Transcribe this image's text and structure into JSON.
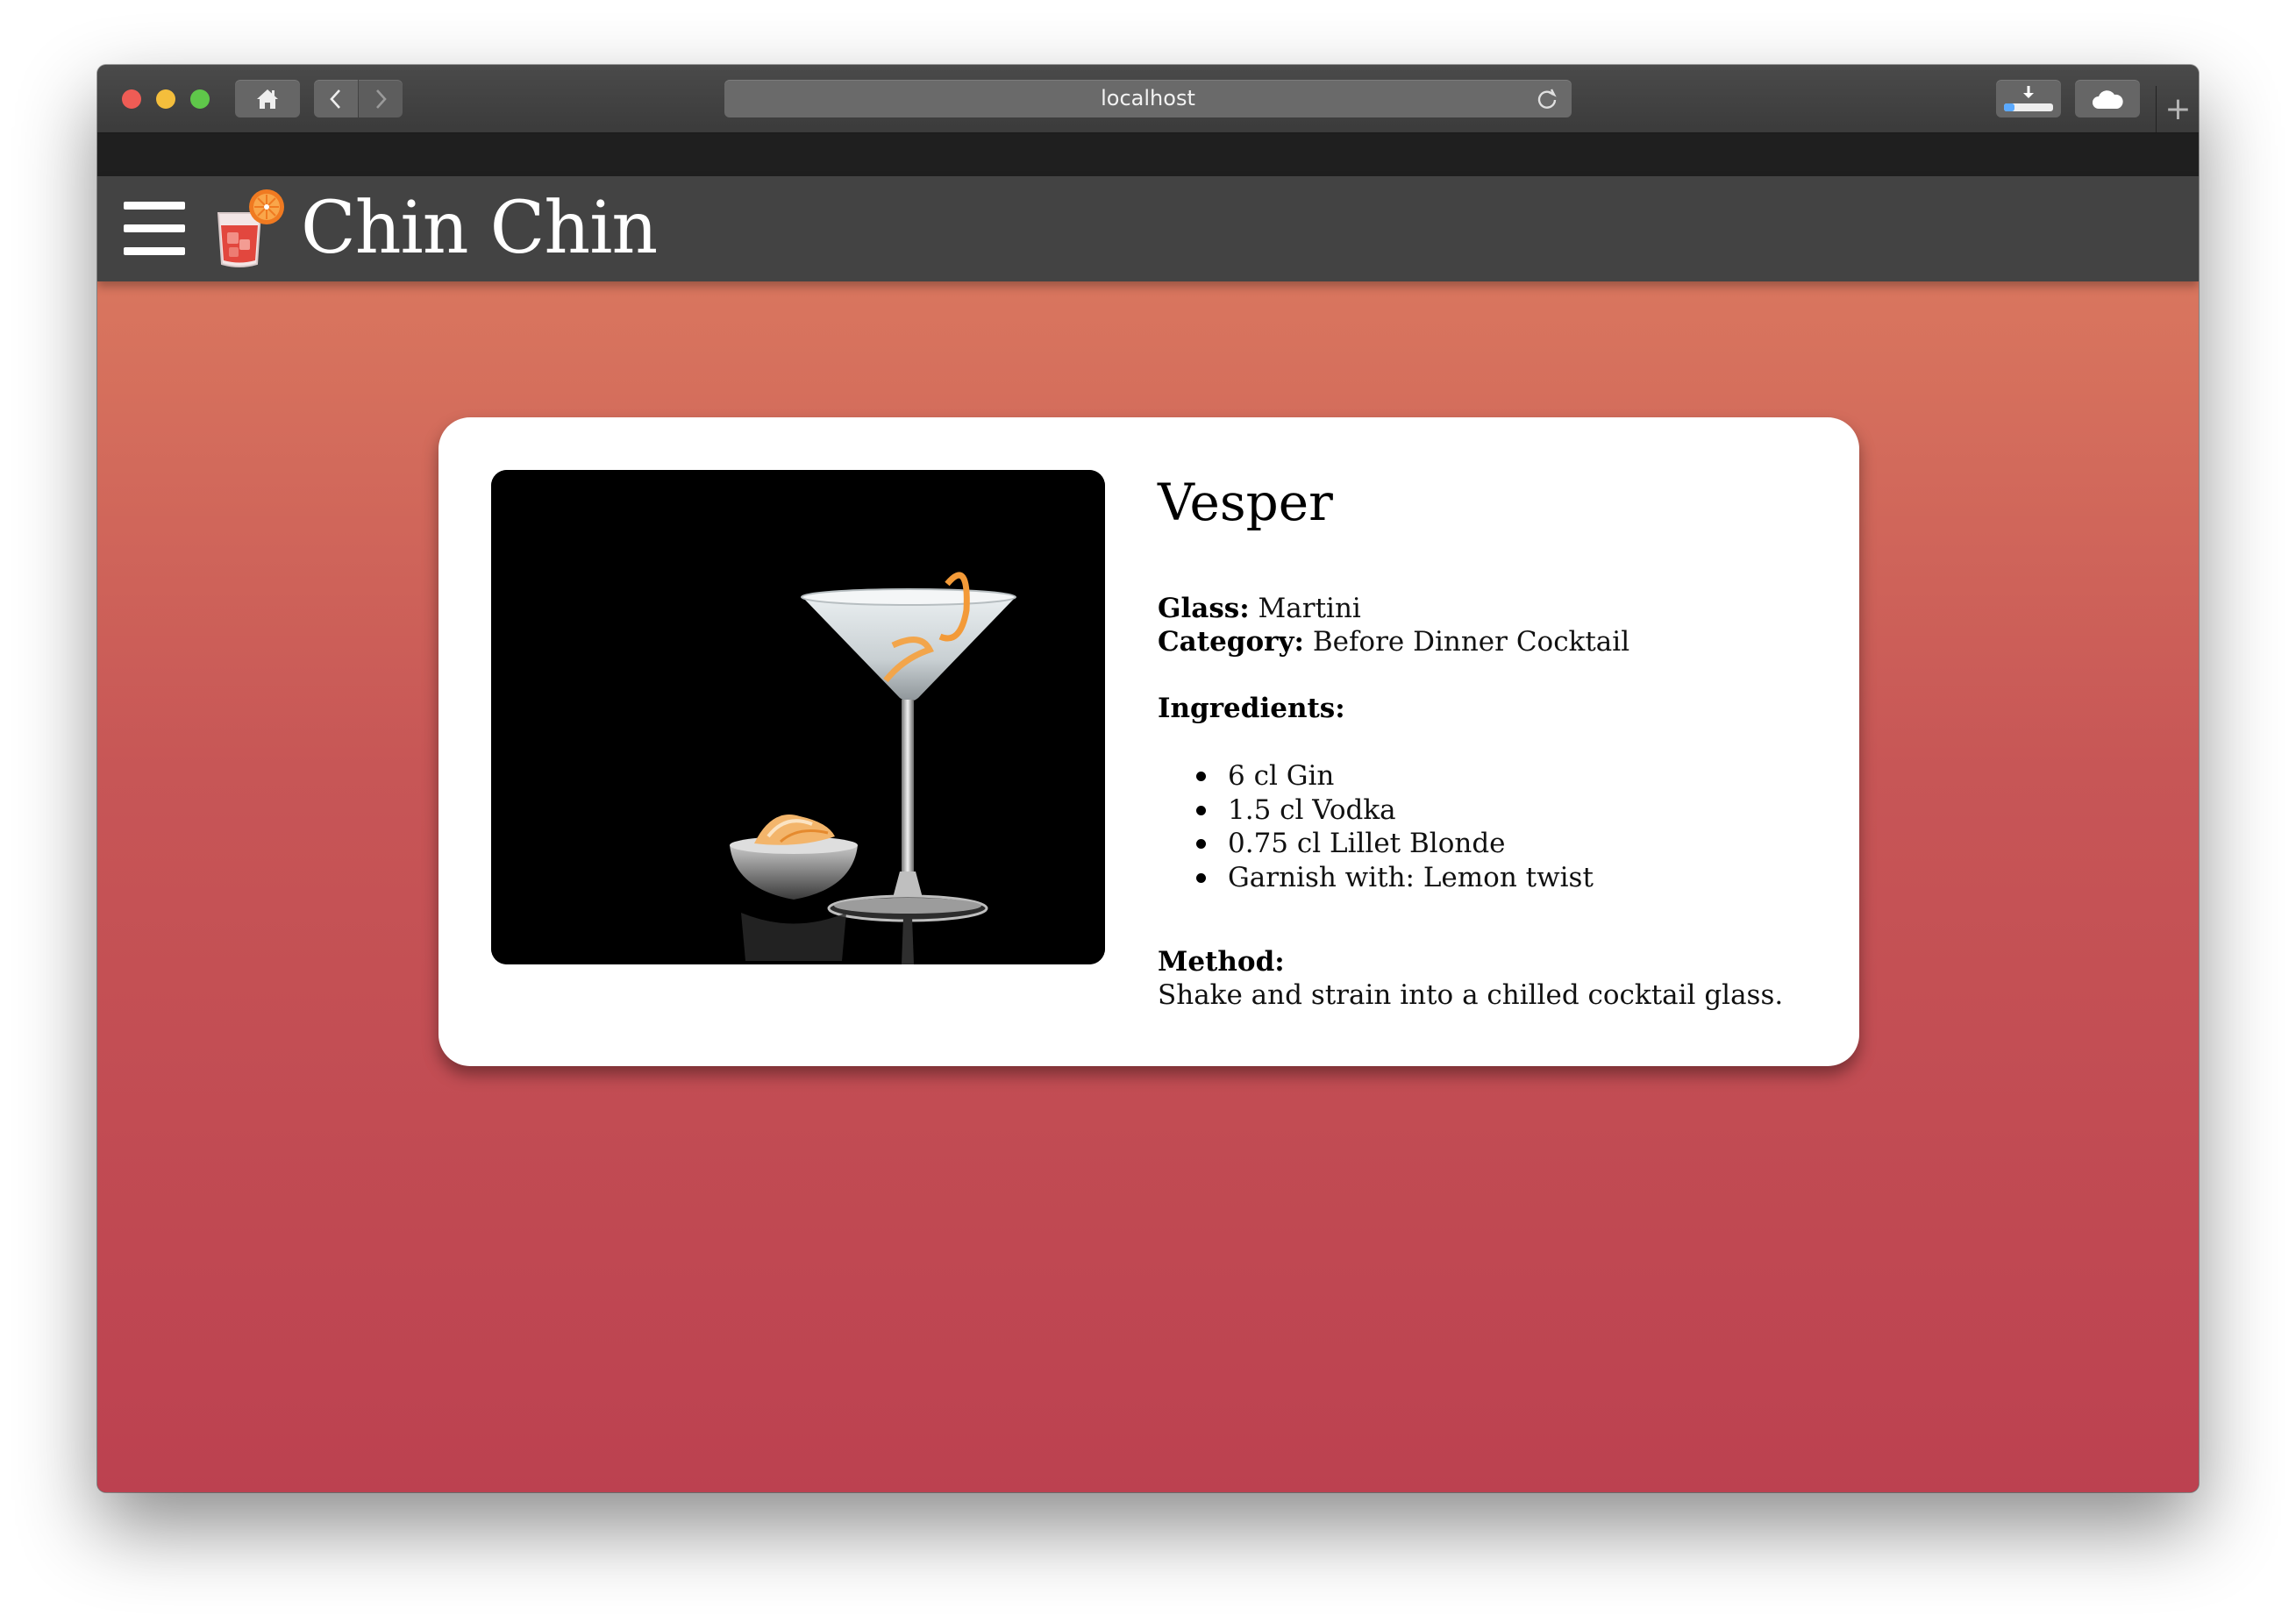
{
  "browser": {
    "url": "localhost",
    "home_icon": "home-icon",
    "back_icon": "chevron-left-icon",
    "forward_icon": "chevron-right-icon",
    "reload_icon": "reload-icon",
    "downloads_icon": "download-icon",
    "cloud_icon": "cloud-icon",
    "new_tab_label": "+"
  },
  "app": {
    "title": "Chin Chin",
    "menu_icon": "hamburger-menu-icon",
    "logo_icon": "cocktail-glass-icon",
    "colors": {
      "appbar": "#434343",
      "gradient_top": "#dd7d60",
      "gradient_bottom": "#bc4150"
    }
  },
  "cocktail": {
    "name": "Vesper",
    "glass_label": "Glass:",
    "glass": "Martini",
    "category_label": "Category:",
    "category": "Before Dinner Cocktail",
    "ingredients_label": "Ingredients:",
    "ingredients": [
      "6 cl Gin",
      "1.5 cl Vodka",
      "0.75 cl Lillet Blonde",
      "Garnish with: Lemon twist"
    ],
    "method_label": "Method:",
    "method": "Shake and strain into a chilled cocktail glass."
  }
}
